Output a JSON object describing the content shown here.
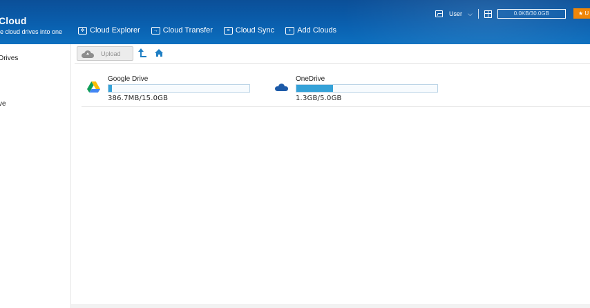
{
  "brand": {
    "name": "Cloud",
    "tagline": "le cloud drives into one"
  },
  "nav": [
    {
      "label": "Cloud Explorer",
      "icon": "explorer-icon"
    },
    {
      "label": "Cloud Transfer",
      "icon": "transfer-icon"
    },
    {
      "label": "Cloud Sync",
      "icon": "sync-icon"
    },
    {
      "label": "Add Clouds",
      "icon": "add-clouds-icon"
    }
  ],
  "user": {
    "name": "User",
    "quota": "0.0KB/30.0GB"
  },
  "upgrade": {
    "label": "★ U"
  },
  "sidebar": {
    "items": [
      {
        "label": "Drives"
      },
      {
        "label": "ve"
      }
    ]
  },
  "toolbar": {
    "upload_label": "Upload"
  },
  "drives": [
    {
      "name": "Google Drive",
      "usage": "386.7MB/15.0GB",
      "used_fraction": 0.025,
      "icon": "google-drive-icon"
    },
    {
      "name": "OneDrive",
      "usage": "1.3GB/5.0GB",
      "used_fraction": 0.26,
      "icon": "onedrive-icon"
    }
  ],
  "colors": {
    "header": "#0a5fae",
    "accent": "#1f7fc4",
    "bar_fill": "#35a2d8",
    "upgrade": "#f08200"
  }
}
